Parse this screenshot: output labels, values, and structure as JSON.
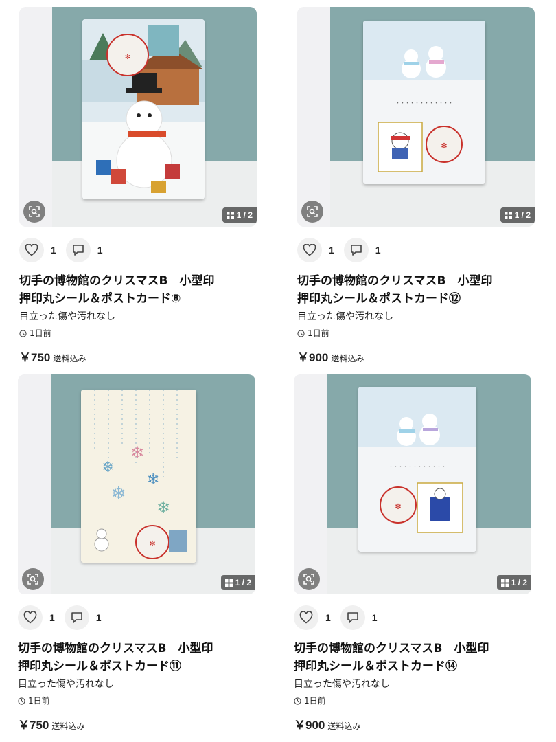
{
  "listings": [
    {
      "title_line1": "切手の博物館のクリスマスB　小型印",
      "title_line2": "押印丸シール＆ポストカード⑧",
      "condition": "目立った傷や汚れなし",
      "time": "1日前",
      "price": "￥750",
      "shipping": "送料込み",
      "likes": "1",
      "comments": "1",
      "image_count": "1 / 2",
      "card_colors": {
        "bg": "#e8f1f5",
        "accent": "#c9322c"
      }
    },
    {
      "title_line1": "切手の博物館のクリスマスB　小型印",
      "title_line2": "押印丸シール＆ポストカード⑫",
      "condition": "目立った傷や汚れなし",
      "time": "1日前",
      "price": "￥900",
      "shipping": "送料込み",
      "likes": "1",
      "comments": "1",
      "image_count": "1 / 2",
      "card_colors": {
        "bg": "#f4f6f8",
        "accent": "#8fc3d9"
      }
    },
    {
      "title_line1": "切手の博物館のクリスマスB　小型印",
      "title_line2": "押印丸シール＆ポストカード⑪",
      "condition": "目立った傷や汚れなし",
      "time": "1日前",
      "price": "￥750",
      "shipping": "送料込み",
      "likes": "1",
      "comments": "1",
      "image_count": "1 / 2",
      "card_colors": {
        "bg": "#f7f3e6",
        "accent": "#5aa7c8"
      }
    },
    {
      "title_line1": "切手の博物館のクリスマスB　小型印",
      "title_line2": "押印丸シール＆ポストカード⑭",
      "condition": "目立った傷や汚れなし",
      "time": "1日前",
      "price": "￥900",
      "shipping": "送料込み",
      "likes": "1",
      "comments": "1",
      "image_count": "1 / 2",
      "card_colors": {
        "bg": "#f4f6f8",
        "accent": "#8fc3d9"
      }
    }
  ],
  "icons": {
    "lens": "image-search-icon",
    "like": "heart-icon",
    "comment": "comment-icon",
    "clock": "clock-icon",
    "grid": "gallery-grid-icon"
  }
}
